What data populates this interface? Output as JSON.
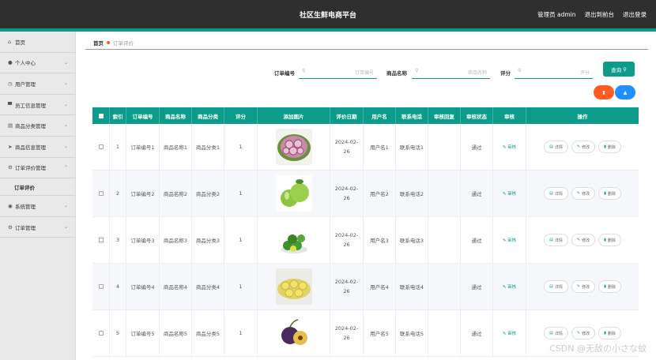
{
  "topbar": {
    "title": "社区生鲜电商平台",
    "admin": "管理员 admin",
    "exit_front": "退出到前台",
    "logout": "退出登录"
  },
  "sidebar": {
    "items": [
      {
        "label": "首页",
        "icon": "home-icon",
        "chev": false
      },
      {
        "label": "个人中心",
        "icon": "user-icon",
        "chev": true
      },
      {
        "label": "用户管理",
        "icon": "clock-icon",
        "chev": true
      },
      {
        "label": "员工信息管理",
        "icon": "monitor-icon",
        "chev": true
      },
      {
        "label": "商品分类管理",
        "icon": "list-icon",
        "chev": true
      },
      {
        "label": "商品信息管理",
        "icon": "send-icon",
        "chev": true
      },
      {
        "label": "订单评价管理",
        "icon": "gear-icon",
        "chev": true
      }
    ],
    "sub_item": "订单评价",
    "items_after": [
      {
        "label": "系统管理",
        "icon": "pin-icon",
        "chev": true
      },
      {
        "label": "订单管理",
        "icon": "gear-icon",
        "chev": true
      }
    ]
  },
  "breadcrumb": {
    "home": "首页",
    "current": "订单评价"
  },
  "search": {
    "order_no_label": "订单编号",
    "order_no_placeholder": "订单编号",
    "product_name_label": "商品名称",
    "product_name_placeholder": "商品名称",
    "rating_label": "评分",
    "rating_placeholder": "评分",
    "query_button": "查询"
  },
  "action_buttons": {
    "delete_color": "#ff5a1f",
    "add_color": "#1e90ff"
  },
  "table": {
    "headers": [
      "",
      "索引",
      "订单编号",
      "商品名称",
      "商品分类",
      "评分",
      "添加图片",
      "评价日期",
      "用户名",
      "联系电话",
      "审核回复",
      "审核状态",
      "审核",
      "操作"
    ],
    "audit_label": "审核",
    "op_detail": "详情",
    "op_edit": "修改",
    "op_delete": "删除",
    "rows": [
      {
        "index": "1",
        "order_no": "订单编号1",
        "product": "商品名称1",
        "category": "商品分类1",
        "rating": "1",
        "date_a": "2024-02-",
        "date_b": "26",
        "user": "用户名1",
        "phone": "联系电话1",
        "reply": "",
        "status": "通过",
        "img": "onion"
      },
      {
        "index": "2",
        "order_no": "订单编号2",
        "product": "商品名称2",
        "category": "商品分类2",
        "rating": "1",
        "date_a": "2024-02-",
        "date_b": "26",
        "user": "用户名2",
        "phone": "联系电话2",
        "reply": "",
        "status": "通过",
        "img": "apple"
      },
      {
        "index": "3",
        "order_no": "订单编号3",
        "product": "商品名称3",
        "category": "商品分类3",
        "rating": "1",
        "date_a": "2024-02-",
        "date_b": "26",
        "user": "用户名3",
        "phone": "联系电话3",
        "reply": "",
        "status": "通过",
        "img": "lime"
      },
      {
        "index": "4",
        "order_no": "订单编号4",
        "product": "商品名称4",
        "category": "商品分类4",
        "rating": "1",
        "date_a": "2024-02-",
        "date_b": "26",
        "user": "用户名4",
        "phone": "联系电话4",
        "reply": "",
        "status": "通过",
        "img": "lemon"
      },
      {
        "index": "5",
        "order_no": "订单编号5",
        "product": "商品名称5",
        "category": "商品分类5",
        "rating": "1",
        "date_a": "2024-02-",
        "date_b": "26",
        "user": "用户名5",
        "phone": "联系电话5",
        "reply": "",
        "status": "通过",
        "img": "plum"
      }
    ]
  },
  "watermark": "CSDN @无敌の小さな蚊"
}
